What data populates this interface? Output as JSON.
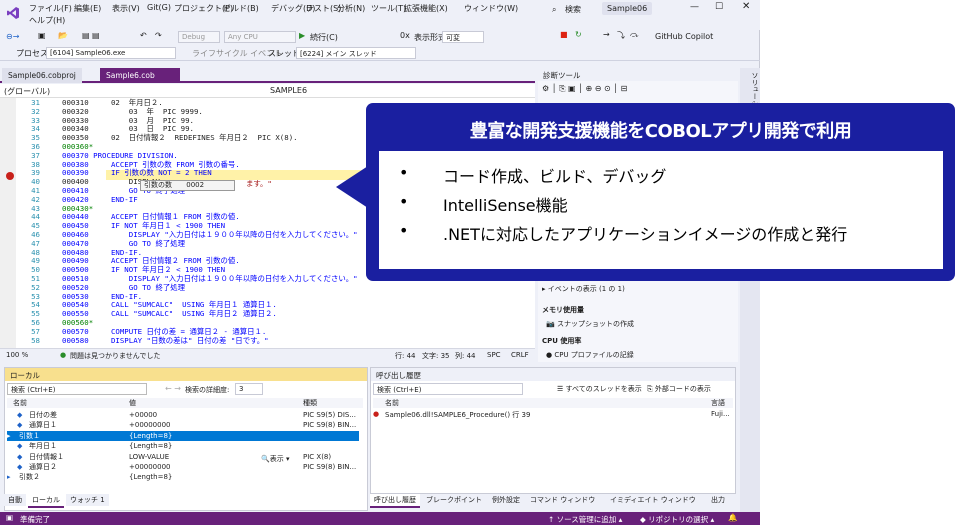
{
  "menu": [
    "ファイル(F)",
    "編集(E)",
    "表示(V)",
    "Git(G)",
    "プロジェクト(P)",
    "ビルド(B)",
    "デバッグ(D)",
    "テスト(S)",
    "分析(N)",
    "ツール(T)",
    "拡張機能(X)",
    "ウィンドウ(W)"
  ],
  "menu_help": "ヘルプ(H)",
  "search_label": "検索",
  "window_title": "Sample06",
  "toolbar": {
    "config": "Debug",
    "platform": "Any CPU",
    "continue": "続行(C)",
    "display_format": "表示形式",
    "display_value": "可変",
    "copilot": "GitHub Copilot"
  },
  "debug_bar": {
    "process_label": "プロセス:",
    "process": "[6104] Sample06.exe",
    "lifecycle": "ライフサイクル イベント",
    "thread_label": "スレッド:",
    "thread": "[6224] メイン スレッド"
  },
  "tabs": [
    "Sample06.cobproj",
    "Sample6.cob"
  ],
  "nav": {
    "scope": "(グローバル)",
    "member": "SAMPLE6"
  },
  "code_lines": [
    {
      "n": "31",
      "t": "000310     02  年月日２."
    },
    {
      "n": "32",
      "t": "000320         03  年  PIC 9999."
    },
    {
      "n": "33",
      "t": "000330         03  月  PIC 99."
    },
    {
      "n": "34",
      "t": "000340         03  日  PIC 99."
    },
    {
      "n": "35",
      "t": "000350     02  日付情報２  REDEFINES 年月日２  PIC X(8)."
    },
    {
      "n": "36",
      "t": "000360*"
    },
    {
      "n": "37",
      "t": "000370 PROCEDURE DIVISION."
    },
    {
      "n": "38",
      "t": "000380     ACCEPT 引数の数 FROM 引数の番号."
    },
    {
      "n": "39",
      "t": "000390     IF 引数の数 NOT = 2 THEN"
    },
    {
      "n": "40",
      "t": "000400         DISPLAY"
    },
    {
      "n": "41",
      "t": "000410         GO TO 終了処理"
    },
    {
      "n": "42",
      "t": "000420     END-IF"
    },
    {
      "n": "43",
      "t": "000430*"
    },
    {
      "n": "44",
      "t": "000440     ACCEPT 日付情報１ FROM 引数の値."
    },
    {
      "n": "45",
      "t": "000450     IF NOT 年月日１ < 1900 THEN"
    },
    {
      "n": "46",
      "t": "000460         DISPLAY \"入力日付は１９００年以降の日付を入力してください。\""
    },
    {
      "n": "47",
      "t": "000470         GO TO 終了処理"
    },
    {
      "n": "48",
      "t": "000480     END-IF."
    },
    {
      "n": "49",
      "t": "000490     ACCEPT 日付情報２ FROM 引数の値."
    },
    {
      "n": "50",
      "t": "000500     IF NOT 年月日２ < 1900 THEN"
    },
    {
      "n": "51",
      "t": "000510         DISPLAY \"入力日付は１９００年以降の日付を入力してください。\""
    },
    {
      "n": "52",
      "t": "000520         GO TO 終了処理"
    },
    {
      "n": "53",
      "t": "000530     END-IF."
    },
    {
      "n": "54",
      "t": "000540     CALL \"SUMCALC\"  USING 年月日１ 通算日１."
    },
    {
      "n": "55",
      "t": "000550     CALL \"SUMCALC\"  USING 年月日２ 通算日２."
    },
    {
      "n": "56",
      "t": "000560*"
    },
    {
      "n": "57",
      "t": "000570     COMPUTE 日付の差 = 通算日２ - 通算日１."
    },
    {
      "n": "58",
      "t": "000580     DISPLAY \"日数の差は\" 日付の差 \"日です。\""
    }
  ],
  "datatip": {
    "name": "引数の数",
    "value": "0002",
    "suffix": "ます。\""
  },
  "editor_status": {
    "zoom": "100 %",
    "issues": "問題は見つかりませんでした",
    "line": "行: 44",
    "char": "文字: 35",
    "col": "列: 44",
    "spc": "SPC",
    "crlf": "CRLF"
  },
  "diag": {
    "title": "診断ツール",
    "events": "イベントの表示 (1 の 1)",
    "memory": "メモリ使用量",
    "snapshot": "スナップショットの作成",
    "cpu": "CPU 使用率",
    "cpu_rec": "CPU プロファイルの記録"
  },
  "locals": {
    "title": "ローカル",
    "search": "検索 (Ctrl+E)",
    "depth_label": "検索の詳細度:",
    "depth": "3",
    "headers": [
      "名前",
      "値",
      "種類"
    ],
    "rows": [
      {
        "name": "日付の差",
        "value": "+00000",
        "type": "PIC S9(5)  DIS..."
      },
      {
        "name": "通算日１",
        "value": "+00000000",
        "type": "PIC S9(8)  BIN..."
      },
      {
        "name": "引数１",
        "value": "{Length=8}",
        "type": ""
      },
      {
        "name": "年月日１",
        "value": "{Length=8}",
        "type": ""
      },
      {
        "name": "日付情報１",
        "value": "LOW-VALUE",
        "type": "PIC X(8)"
      },
      {
        "name": "通算日２",
        "value": "+00000000",
        "type": "PIC S9(8)  BIN..."
      },
      {
        "name": "引数２",
        "value": "{Length=8}",
        "type": ""
      }
    ],
    "view_label": "表示",
    "tabs": [
      "自動",
      "ローカル",
      "ウォッチ 1"
    ]
  },
  "callstack": {
    "title": "呼び出し履歴",
    "search": "検索 (Ctrl+E)",
    "all_threads": "すべてのスレッドを表示",
    "external": "外部コードの表示",
    "headers": [
      "名前",
      "言語"
    ],
    "row": "Sample06.dll!SAMPLE6_Procedure() 行 39",
    "lang": "Fuji...",
    "tabs": [
      "呼び出し履歴",
      "ブレークポイント",
      "例外設定",
      "コマンド ウィンドウ",
      "イミディエイト ウィンドウ",
      "出力"
    ]
  },
  "statusbar": {
    "ready": "準備完了",
    "source": "ソース管理に追加",
    "repo": "リポジトリの選択"
  },
  "side_label": "ソリューション エクスプローラー",
  "callout": {
    "title": "豊富な開発支援機能をCOBOLアプリ開発で利用",
    "bullets": [
      "コード作成、ビルド、デバッグ",
      "IntelliSense機能",
      ".NETに対応したアプリケーションイメージの作成と発行"
    ],
    "bullet_mark": "•"
  },
  "colors": {
    "accent": "#68217a",
    "callout": "#1a1fa0",
    "selection": "#0078d4"
  }
}
